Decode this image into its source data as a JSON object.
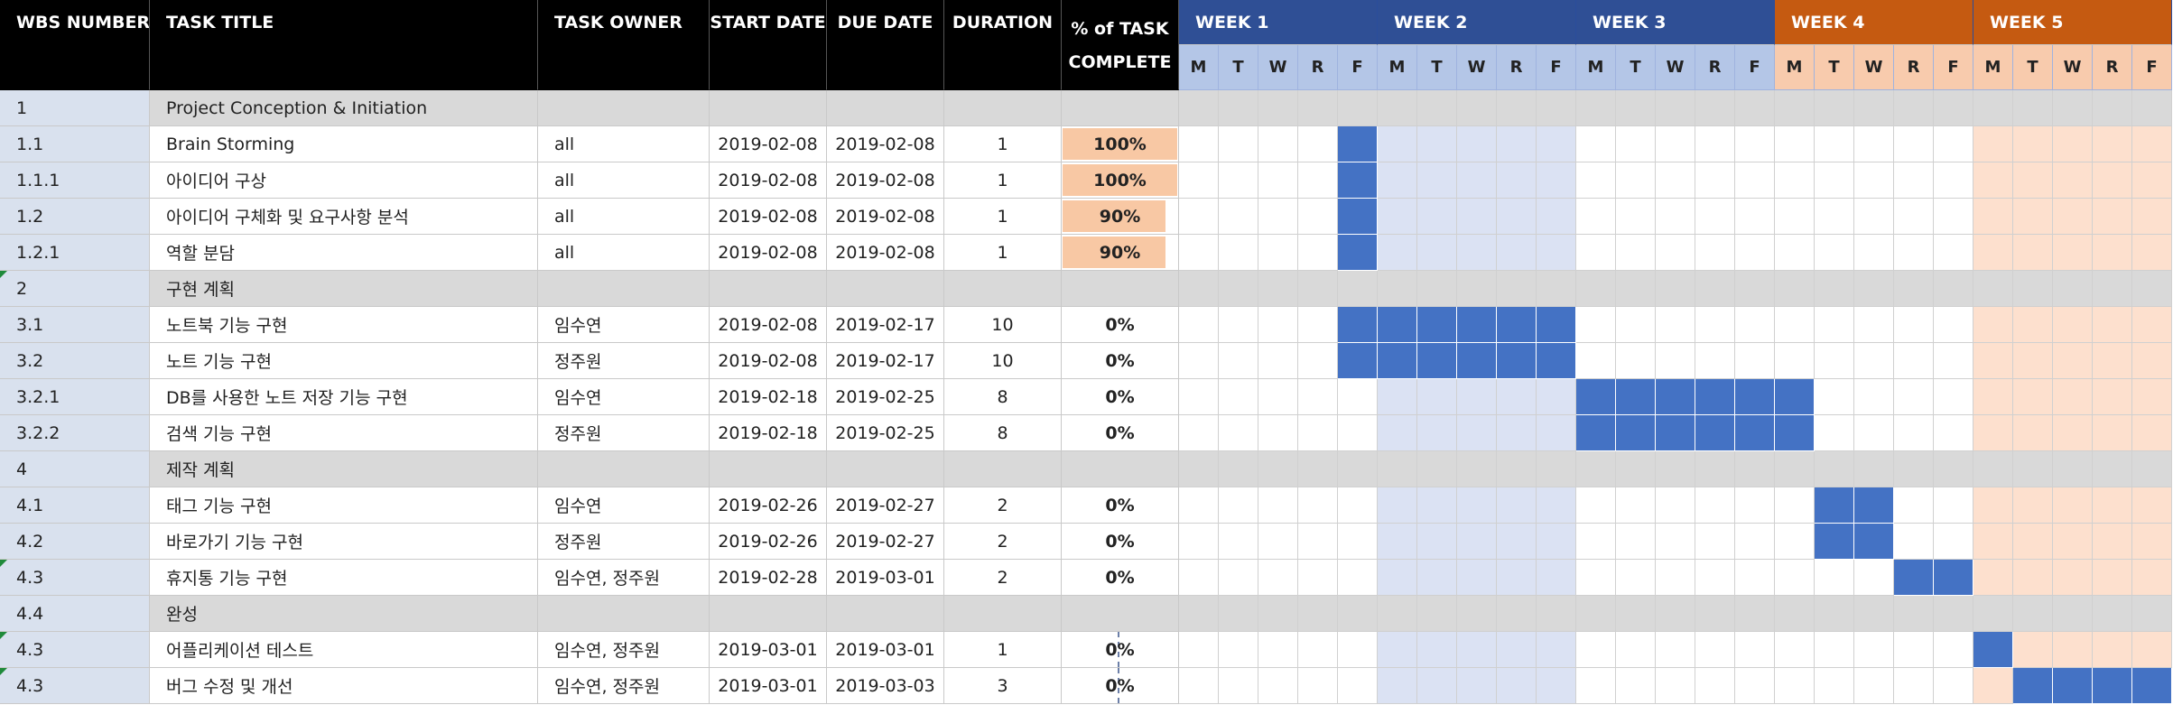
{
  "headers": {
    "wbs": "WBS NUMBER",
    "title": "TASK TITLE",
    "owner": "TASK OWNER",
    "start": "START DATE",
    "due": "DUE DATE",
    "duration": "DURATION",
    "pct_line1": "% of TASK",
    "pct_line2": "COMPLETE"
  },
  "weeks": [
    {
      "label": "WEEK 1",
      "color": "#2f4f95"
    },
    {
      "label": "WEEK 2",
      "color": "#2f4f95"
    },
    {
      "label": "WEEK 3",
      "color": "#2f4f95"
    },
    {
      "label": "WEEK 4",
      "color": "#c55a11"
    },
    {
      "label": "WEEK 5",
      "color": "#c55a11"
    }
  ],
  "day_letters": [
    "M",
    "T",
    "W",
    "R",
    "F"
  ],
  "day_colors": {
    "blue": "#b4c6e7",
    "orange": "#f8cbad"
  },
  "rows": [
    {
      "kind": "phase",
      "wbs": "1",
      "title": "Project Conception & Initiation"
    },
    {
      "kind": "task",
      "wbs": "1.1",
      "title": "Brain Storming",
      "owner": "all",
      "start": "2019-02-08",
      "due": "2019-02-08",
      "duration": "1",
      "pct": "100%",
      "pct_value": 100,
      "bar": [
        5,
        5
      ]
    },
    {
      "kind": "task",
      "wbs": "1.1.1",
      "title": "아이디어 구상",
      "owner": "all",
      "start": "2019-02-08",
      "due": "2019-02-08",
      "duration": "1",
      "pct": "100%",
      "pct_value": 100,
      "bar": [
        5,
        5
      ]
    },
    {
      "kind": "task",
      "wbs": "1.2",
      "title": "아이디어 구체화 및 요구사항 분석",
      "owner": "all",
      "start": "2019-02-08",
      "due": "2019-02-08",
      "duration": "1",
      "pct": "90%",
      "pct_value": 90,
      "bar": [
        5,
        5
      ]
    },
    {
      "kind": "task",
      "wbs": "1.2.1",
      "title": "역할 분담",
      "owner": "all",
      "start": "2019-02-08",
      "due": "2019-02-08",
      "duration": "1",
      "pct": "90%",
      "pct_value": 90,
      "bar": [
        5,
        5
      ]
    },
    {
      "kind": "phase",
      "wbs": "2",
      "title": "구현 계획",
      "flag": true
    },
    {
      "kind": "task",
      "wbs": "3.1",
      "title": "노트북 기능 구현",
      "owner": "임수연",
      "start": "2019-02-08",
      "due": "2019-02-17",
      "duration": "10",
      "pct": "0%",
      "pct_value": 0,
      "bar": [
        5,
        10
      ]
    },
    {
      "kind": "task",
      "wbs": "3.2",
      "title": "노트 기능 구현",
      "owner": "정주원",
      "start": "2019-02-08",
      "due": "2019-02-17",
      "duration": "10",
      "pct": "0%",
      "pct_value": 0,
      "bar": [
        5,
        10
      ]
    },
    {
      "kind": "task",
      "wbs": "3.2.1",
      "title": "DB를 사용한 노트 저장 기능 구현",
      "owner": "임수연",
      "start": "2019-02-18",
      "due": "2019-02-25",
      "duration": "8",
      "pct": "0%",
      "pct_value": 0,
      "bar": [
        11,
        16
      ]
    },
    {
      "kind": "task",
      "wbs": "3.2.2",
      "title": "검색 기능 구현",
      "owner": "정주원",
      "start": "2019-02-18",
      "due": "2019-02-25",
      "duration": "8",
      "pct": "0%",
      "pct_value": 0,
      "bar": [
        11,
        16
      ]
    },
    {
      "kind": "phase",
      "wbs": "4",
      "title": "제작 계획"
    },
    {
      "kind": "task",
      "wbs": "4.1",
      "title": "태그 기능 구현",
      "owner": "임수연",
      "start": "2019-02-26",
      "due": "2019-02-27",
      "duration": "2",
      "pct": "0%",
      "pct_value": 0,
      "bar": [
        17,
        18
      ]
    },
    {
      "kind": "task",
      "wbs": "4.2",
      "title": "바로가기 기능 구현",
      "owner": "정주원",
      "start": "2019-02-26",
      "due": "2019-02-27",
      "duration": "2",
      "pct": "0%",
      "pct_value": 0,
      "bar": [
        17,
        18
      ]
    },
    {
      "kind": "task",
      "wbs": "4.3",
      "title": "휴지통 기능 구현",
      "owner": "임수연, 정주원",
      "start": "2019-02-28",
      "due": "2019-03-01",
      "duration": "2",
      "pct": "0%",
      "pct_value": 0,
      "bar": [
        19,
        20
      ],
      "flag": true
    },
    {
      "kind": "phase",
      "wbs": "4.4",
      "title": "완성"
    },
    {
      "kind": "task",
      "wbs": "4.3",
      "title": "어플리케이션 테스트",
      "owner": "임수연, 정주원",
      "start": "2019-03-01",
      "due": "2019-03-01",
      "duration": "1",
      "pct": "0%",
      "pct_value": 0,
      "bar": [
        21,
        21
      ],
      "flag": true,
      "dash": true
    },
    {
      "kind": "task",
      "wbs": "4.3",
      "title": "버그 수정 및 개선",
      "owner": "임수연, 정주원",
      "start": "2019-03-01",
      "due": "2019-03-03",
      "duration": "3",
      "pct": "0%",
      "pct_value": 0,
      "bar": [
        22,
        25
      ],
      "flag": true,
      "dash": true
    }
  ]
}
